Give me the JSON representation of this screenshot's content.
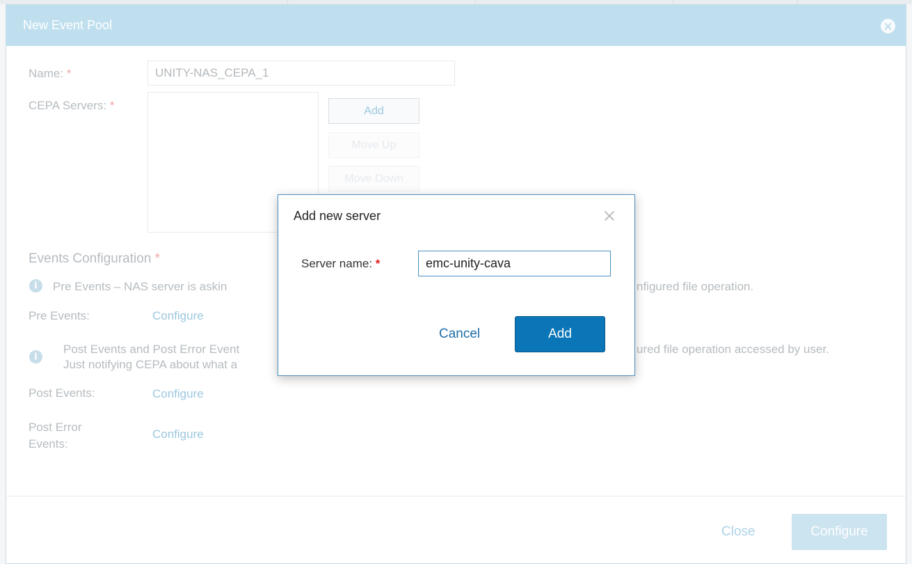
{
  "dialog": {
    "title": "New Event Pool",
    "name_label": "Name:",
    "name_value": "UNITY-NAS_CEPA_1",
    "cepa_servers_label": "CEPA Servers:",
    "required_mark": "*",
    "buttons": {
      "add": "Add",
      "move_up": "Move Up",
      "move_down": "Move Down"
    },
    "events_configuration": {
      "title": "Events Configuration",
      "pre_events_info_left": "Pre Events – NAS server is askin",
      "pre_events_info_right": "nfigured file operation.",
      "pre_events_label": "Pre Events:",
      "post_events_info_line1_left": "Post Events and Post Error Event",
      "post_events_info_line1_right": "ured file operation accessed by user.",
      "post_events_info_line2": "Just notifying CEPA about what a",
      "post_events_label": "Post Events:",
      "post_error_events_label_line1": "Post Error",
      "post_error_events_label_line2": "Events:",
      "configure_link": "Configure"
    },
    "footer": {
      "close": "Close",
      "configure": "Configure"
    }
  },
  "modal": {
    "title": "Add new server",
    "server_name_label": "Server name:",
    "required_mark": "*",
    "server_name_value": "emc-unity-cava",
    "cancel": "Cancel",
    "add": "Add"
  }
}
